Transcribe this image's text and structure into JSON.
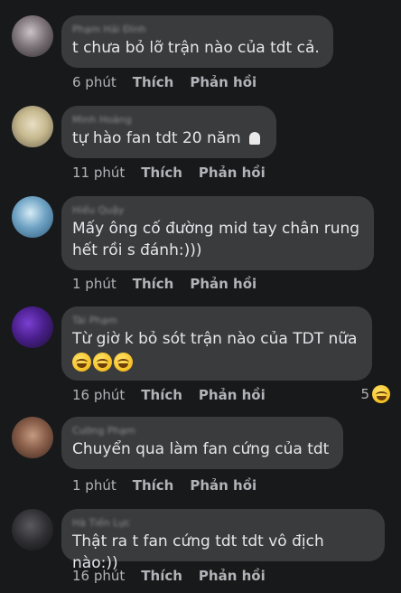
{
  "comments": [
    {
      "author": "Phạm Hải Đình",
      "text": "t chưa bỏ lỡ trận nào của tdt cả.",
      "time": "6 phút",
      "like": "Thích",
      "reply": "Phản hồi"
    },
    {
      "author": "Minh Hoàng",
      "text": "tự hào fan tdt 20 năm",
      "time": "11 phút",
      "like": "Thích",
      "reply": "Phản hồi"
    },
    {
      "author": "Hiếu Quậy",
      "text_line1": "Mấy ông cố đường mid tay chân rung",
      "text_line2": "hết rồi s đánh:)))",
      "time": "1 phút",
      "like": "Thích",
      "reply": "Phản hồi"
    },
    {
      "author": "Tài Phạm",
      "text": "Từ giờ k bỏ sót trận nào của TDT nữa",
      "time": "16 phút",
      "like": "Thích",
      "reply": "Phản hồi",
      "reaction_count": "5"
    },
    {
      "author": "Cường Phạm",
      "text": "Chuyển qua làm fan cứng của tdt",
      "time": "1 phút",
      "like": "Thích",
      "reply": "Phản hồi"
    },
    {
      "author": "Hà Tiến Lực",
      "text": "Thật ra t fan cứng tdt tdt vô địch nào:))",
      "time": "16 phút",
      "like": "Thích",
      "reply": "Phản hồi"
    }
  ],
  "emoji_name": "grinning-squinting-face",
  "colors": {
    "background": "#18191a",
    "bubble": "#3a3b3c",
    "text": "#e4e6eb",
    "meta": "#b0b3b8"
  }
}
